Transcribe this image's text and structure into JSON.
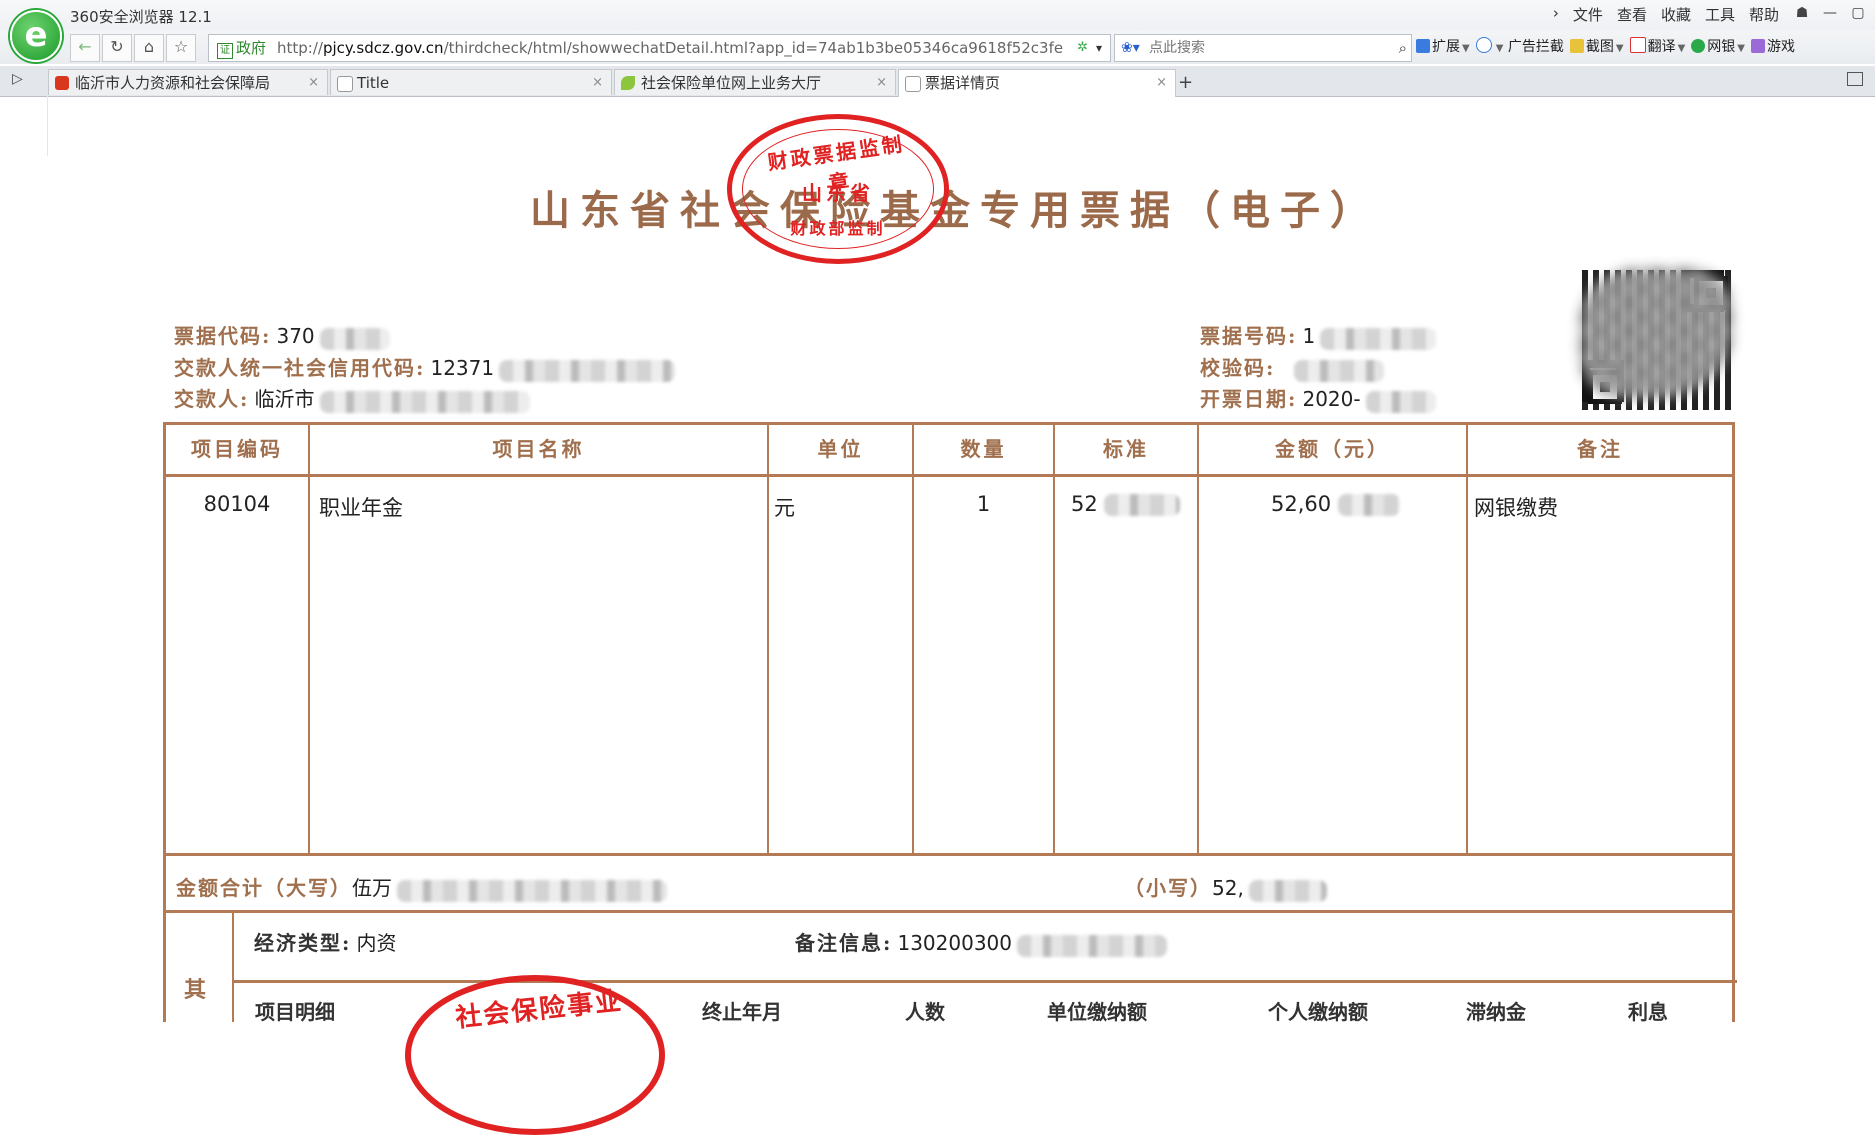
{
  "browser": {
    "app_title": "360安全浏览器 12.1",
    "menu": [
      "文件",
      "查看",
      "收藏",
      "工具",
      "帮助"
    ],
    "window_buttons": [
      "☗",
      "—",
      "▢"
    ],
    "address": {
      "badge_text": "证",
      "badge_label": "政府",
      "url_prefix": "http://",
      "url_host": "pjcy.sdcz.gov.cn",
      "url_path": "/thirdcheck/html/showwechatDetail.html?app_id=74ab1b3be05346ca9618f52c3fe"
    },
    "search_placeholder": "点此搜索",
    "extensions": [
      "扩展",
      "广告拦截",
      "截图",
      "翻译",
      "网银",
      "游戏"
    ],
    "tabs": [
      {
        "label": "临沂市人力资源和社会保障局",
        "icon_color": "#d9361e"
      },
      {
        "label": "Title",
        "icon_color": "#ffffff"
      },
      {
        "label": "社会保险单位网上业务大厅",
        "icon_color": "#8cc63f"
      },
      {
        "label": "票据详情页",
        "icon_color": "#ffffff"
      }
    ],
    "active_tab": 3
  },
  "receipt": {
    "title": "山东省社会保险基金专用票据（电子）",
    "seal": {
      "top": "财政票据监制章",
      "middle": "山东省",
      "bottom": "财政部监制"
    },
    "fields": {
      "code_label": "票据代码:",
      "code_value": "370",
      "payer_credit_label": "交款人统一社会信用代码:",
      "payer_credit_value": "12371",
      "payer_label": "交款人:",
      "payer_value": "临沂市",
      "number_label": "票据号码:",
      "number_value": "1",
      "check_label": "校验码:",
      "check_value": "",
      "date_label": "开票日期:",
      "date_value": "2020-"
    },
    "table": {
      "headers": [
        "项目编码",
        "项目名称",
        "单位",
        "数量",
        "标准",
        "金额（元）",
        "备注"
      ],
      "rows": [
        {
          "code": "80104",
          "name": "职业年金",
          "unit": "元",
          "qty": "1",
          "std": "52",
          "amount": "52,60",
          "remark": "网银缴费"
        }
      ]
    },
    "total": {
      "upper_label": "金额合计（大写）",
      "upper_value": "伍万",
      "lower_label": "（小写）",
      "lower_value": "52,"
    },
    "other": {
      "side_label": "其",
      "econ_label": "经济类型:",
      "econ_value": "内资",
      "remark_label": "备注信息:",
      "remark_value": "130200300",
      "sub_headers": [
        "项目明细",
        "终止年月",
        "人数",
        "单位缴纳额",
        "个人缴纳额",
        "滞纳金",
        "利息"
      ],
      "seal_text": "社会保险事业"
    }
  }
}
